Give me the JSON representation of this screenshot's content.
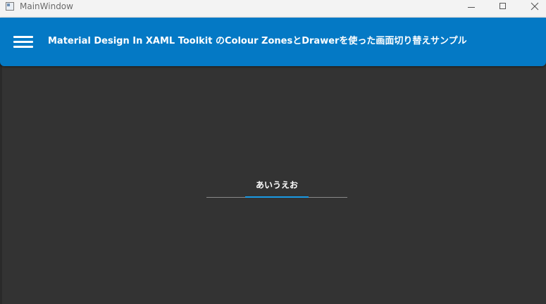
{
  "window": {
    "title": "MainWindow",
    "minimize_icon": "minimize-icon",
    "maximize_icon": "maximize-icon",
    "close_icon": "close-icon"
  },
  "header": {
    "title": "Material Design In XAML Toolkit のColour ZonesとDrawerを使った画面切り替えサンプル",
    "menu_icon": "hamburger-menu-icon",
    "color": "#0479c5"
  },
  "content": {
    "background": "#333333",
    "tabs": [
      {
        "label": "あいうえお",
        "selected": true
      }
    ],
    "indicator_color": "#1a9be6"
  }
}
